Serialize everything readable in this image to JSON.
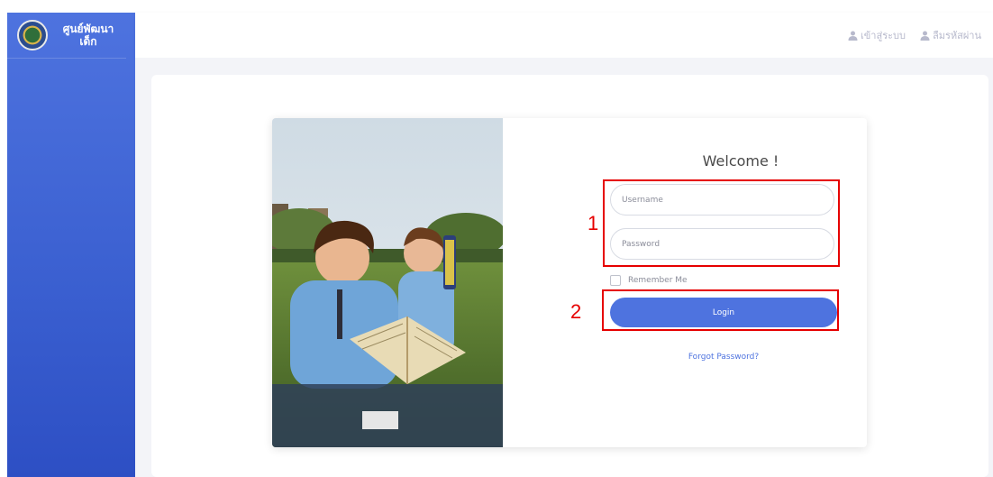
{
  "sidebar": {
    "brand": {
      "title": "ศูนย์พัฒนาเด็ก"
    }
  },
  "topbar": {
    "login_label": "เข้าสู่ระบบ",
    "forgot_label": "ลืมรหัสผ่าน"
  },
  "login": {
    "welcome": "Welcome !",
    "username_placeholder": "Username",
    "password_placeholder": "Password",
    "remember_label": "Remember Me",
    "login_button": "Login",
    "forgot_link": "Forgot Password?"
  },
  "annotations": [
    "1",
    "2"
  ],
  "colors": {
    "primary": "#4e73df",
    "annotation": "#e60000",
    "topbar_text": "#b7b9cc"
  },
  "icons": [
    "user-icon"
  ]
}
